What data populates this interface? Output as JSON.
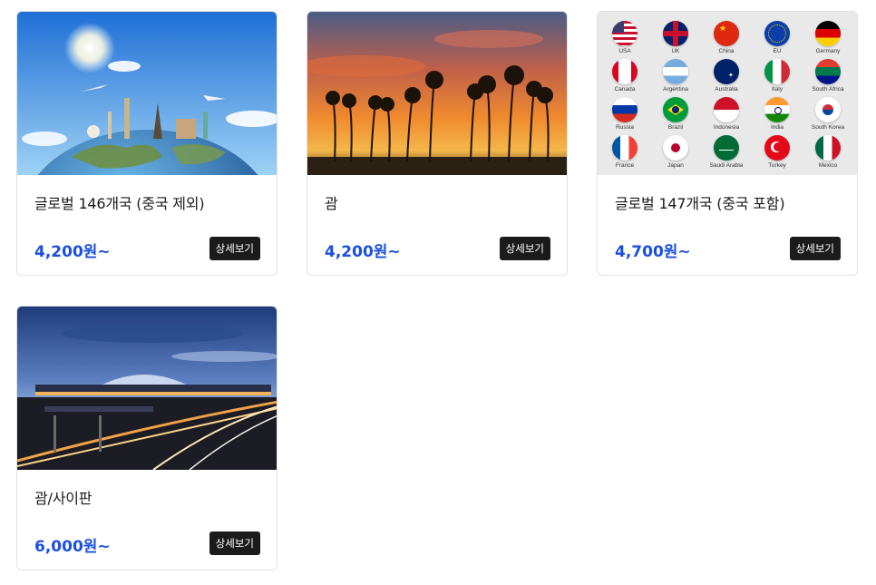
{
  "cards": [
    {
      "title": "글로벌 146개국 (중국 제외)",
      "price": "4,200원~",
      "button": "상세보기",
      "image": "world-landmarks-globe"
    },
    {
      "title": "괌",
      "price": "4,200원~",
      "button": "상세보기",
      "image": "palm-tree-sunset"
    },
    {
      "title": "글로벌 147개국 (중국 포함)",
      "price": "4,700원~",
      "button": "상세보기",
      "image": "country-flags-grid",
      "flags": [
        "USA",
        "UK",
        "China",
        "EU",
        "Germany",
        "Canada",
        "Argentina",
        "Australia",
        "Italy",
        "South Africa",
        "Russia",
        "Brazil",
        "Indonesia",
        "India",
        "South Korea",
        "France",
        "Japan",
        "Saudi Arabia",
        "Turkey",
        "Mexico"
      ]
    },
    {
      "title": "괌/사이판",
      "price": "6,000원~",
      "button": "상세보기",
      "image": "airport-night"
    }
  ],
  "colors": {
    "price": "#1a4fe0",
    "button_bg": "#1b1b1b"
  }
}
